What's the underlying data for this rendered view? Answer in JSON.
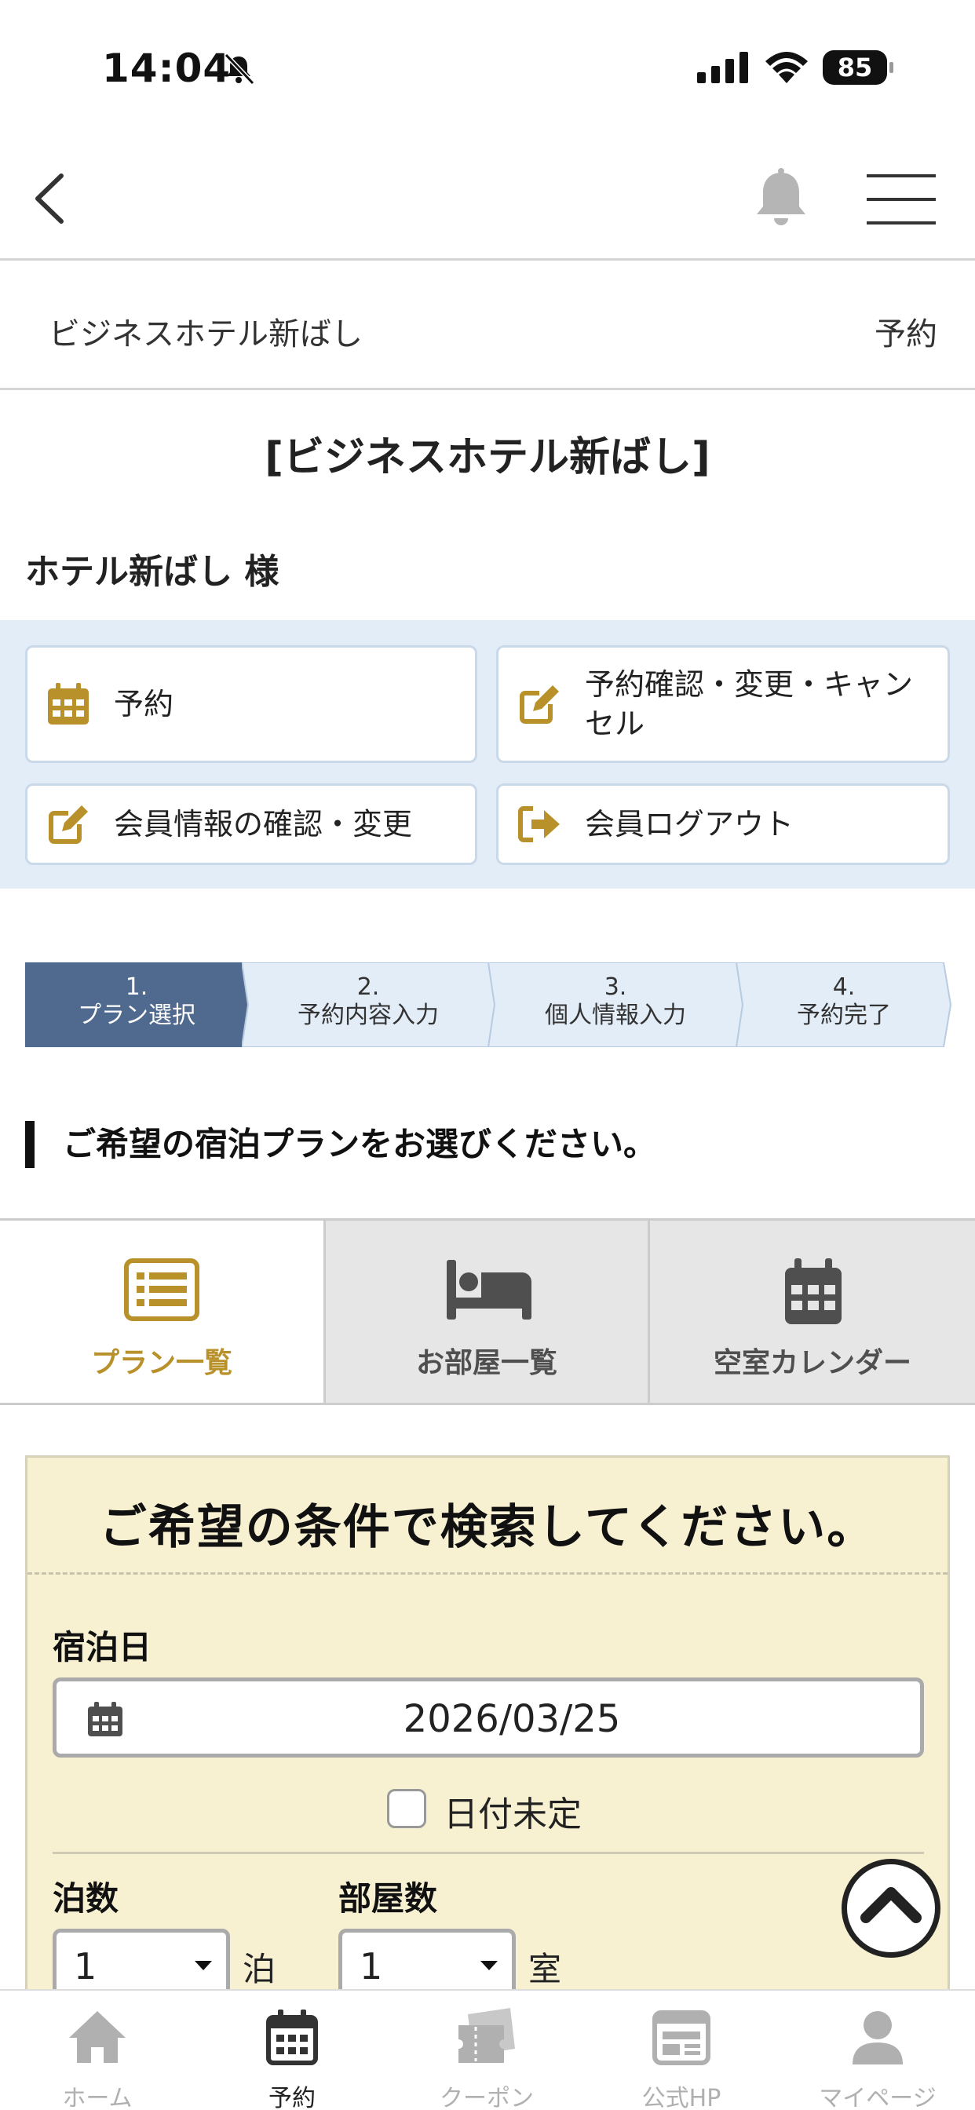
{
  "status_bar": {
    "time": "14:04",
    "battery": "85"
  },
  "breadcrumb": {
    "hotel_name": "ビジネスホテル新ばし",
    "current": "予約"
  },
  "hotel_title": "[ビジネスホテル新ばし]",
  "guest_name": "ホテル新ばし 様",
  "member_menu": {
    "reserve": "予約",
    "confirm_change_cancel": "予約確認・変更・キャンセル",
    "member_info": "会員情報の確認・変更",
    "logout": "会員ログアウト"
  },
  "steps": [
    {
      "num": "1.",
      "label": "プラン選択",
      "active": true
    },
    {
      "num": "2.",
      "label": "予約内容入力",
      "active": false
    },
    {
      "num": "3.",
      "label": "個人情報入力",
      "active": false
    },
    {
      "num": "4.",
      "label": "予約完了",
      "active": false
    }
  ],
  "section_heading": "ご希望の宿泊プランをお選びください。",
  "view_tabs": [
    {
      "label": "プラン一覧",
      "icon": "list-icon",
      "active": true
    },
    {
      "label": "お部屋一覧",
      "icon": "bed-icon",
      "active": false
    },
    {
      "label": "空室カレンダー",
      "icon": "calendar-icon",
      "active": false
    }
  ],
  "search": {
    "heading": "ご希望の条件で検索してください。",
    "stay_date_label": "宿泊日",
    "stay_date_value": "2026/03/25",
    "date_undecided_label": "日付未定",
    "nights_label": "泊数",
    "nights_value": "1",
    "nights_unit": "泊",
    "rooms_label": "部屋数",
    "rooms_value": "1",
    "rooms_unit": "室"
  },
  "tabbar": [
    {
      "label": "ホーム",
      "icon": "home-icon",
      "active": false
    },
    {
      "label": "予約",
      "icon": "calendar-icon",
      "active": true
    },
    {
      "label": "クーポン",
      "icon": "coupon-icon",
      "active": false
    },
    {
      "label": "公式HP",
      "icon": "website-icon",
      "active": false
    },
    {
      "label": "マイページ",
      "icon": "person-icon",
      "active": false
    }
  ],
  "colors": {
    "accent_gold": "#b8912b",
    "step_active": "#4f6a8e",
    "step_inactive": "#e3edf8",
    "panel_bg": "#f7f1d2",
    "member_bg": "#e3edf8"
  }
}
